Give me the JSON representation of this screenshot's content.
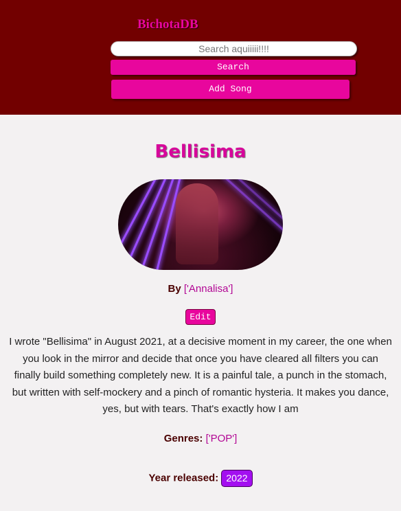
{
  "header": {
    "logo": "BichotaDB",
    "search_placeholder": "Search aquiiiii!!!!",
    "search_button": "Search",
    "add_button": "Add Song"
  },
  "song": {
    "title": "Bellisima",
    "by_label": "By",
    "artists": "['Annalisa']",
    "edit_button": "Edit",
    "description": "I wrote \"Bellisima\" in August 2021, at a decisive moment in my career, the one when you look in the mirror and decide that once you have cleared all filters you can finally build something completely new. It is a painful tale, a punch in the stomach, but written with self-mockery and a pinch of romantic hysteria. It makes you dance, yes, but with tears. That's exactly how I am",
    "genres_label": "Genres:",
    "genres": "['POP']",
    "year_label": "Year released:",
    "year": "2022"
  },
  "colors": {
    "header_bg": "#720000",
    "accent_pink": "#e8069d",
    "title_pink": "#d7069b",
    "year_badge": "#a30ff0",
    "page_bg": "#f3f1f2"
  }
}
